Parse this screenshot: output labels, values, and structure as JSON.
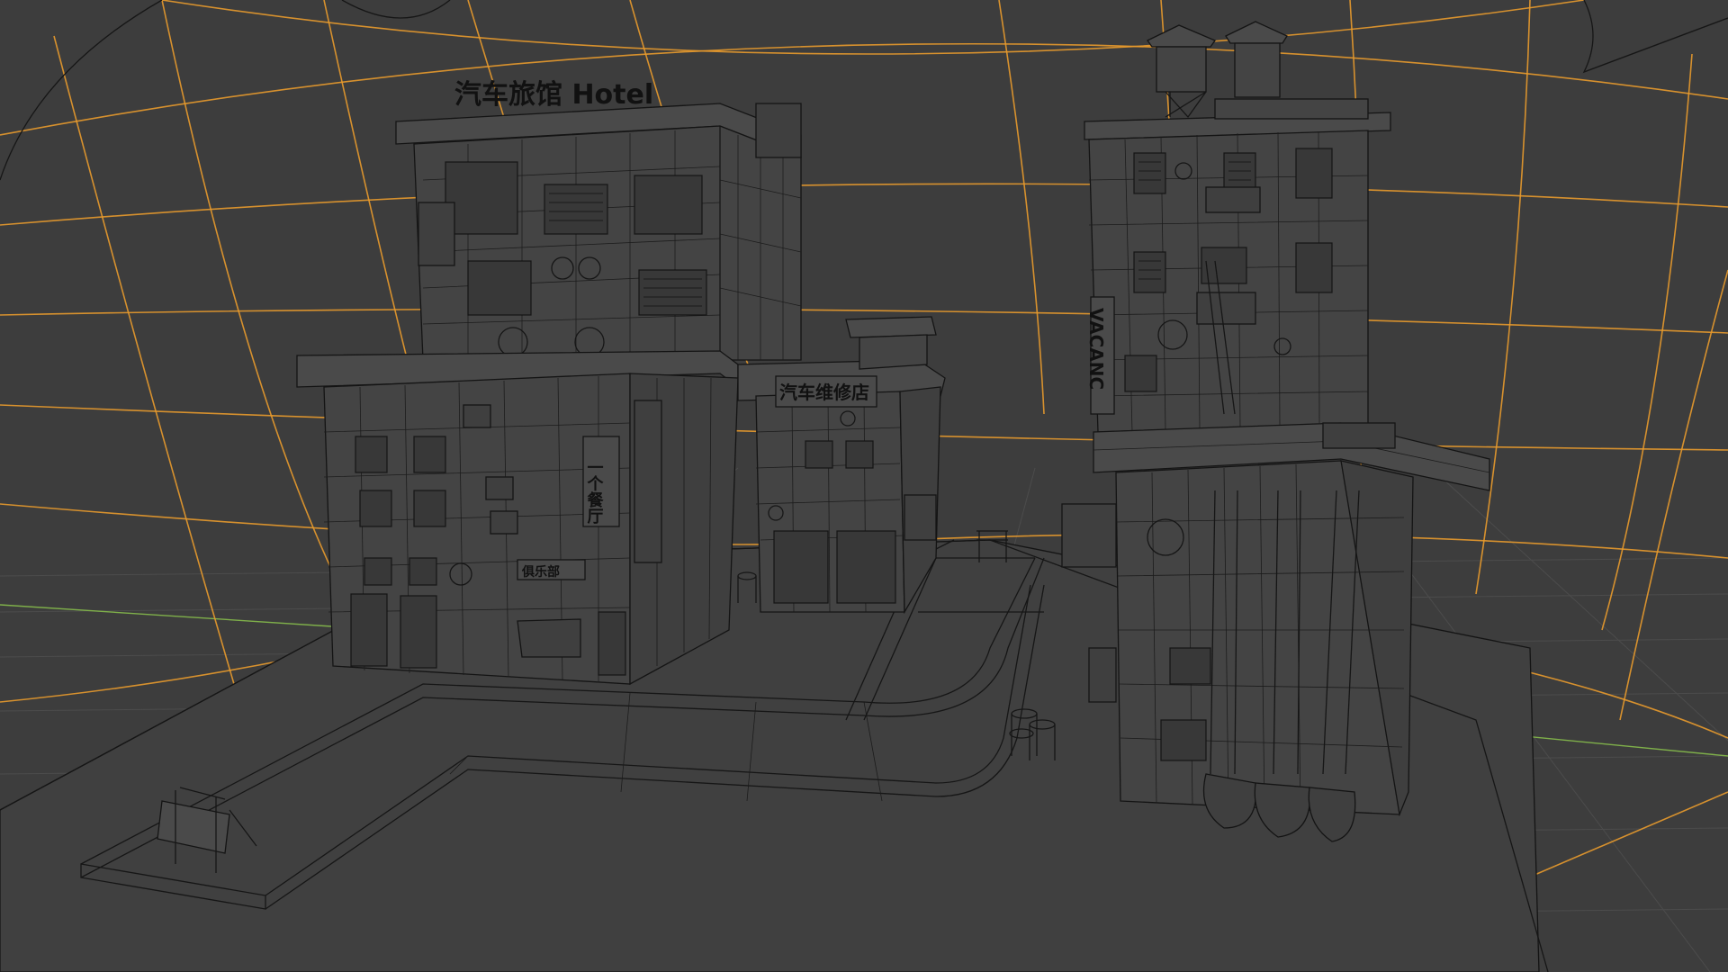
{
  "viewport": {
    "background": "#3d3d3d",
    "floor_grid_color": "#4c4c4c",
    "curved_grid_color": "#e89a2c",
    "x_axis_color": "#c04b5a",
    "y_axis_color": "#7fb04a",
    "wire_color": "#161616"
  },
  "signs": {
    "hotel": "汽车旅馆 Hotel",
    "repair_shop": "汽车维修店",
    "restaurant": "一个餐厅",
    "club": "俱乐部",
    "vacancy": "VACANC"
  }
}
